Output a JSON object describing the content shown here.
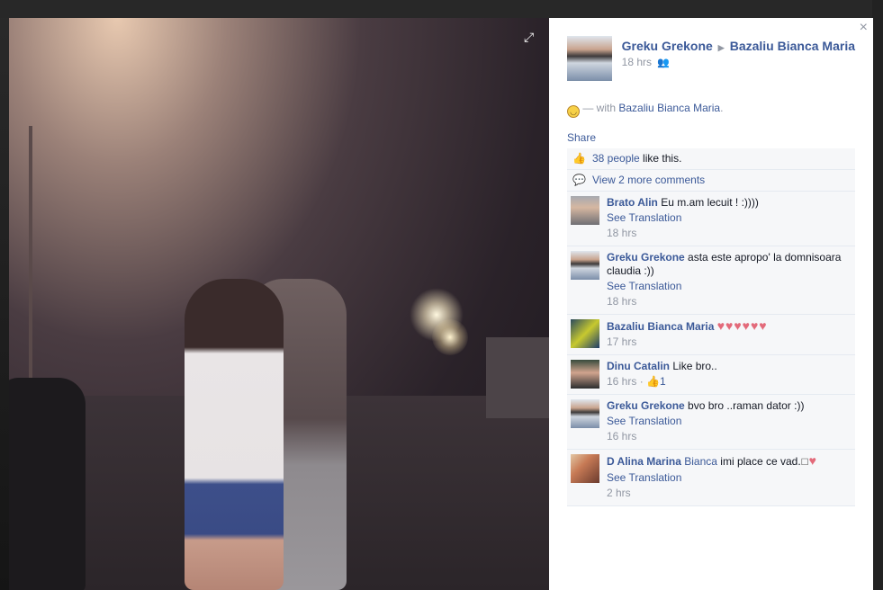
{
  "photo": {
    "expand_icon": "expand-icon"
  },
  "post": {
    "author": "Greku Grekone",
    "target": "Bazaliu Bianca Maria",
    "time": "18 hrs",
    "caption_prefix": "— with",
    "caption_tag": "Bazaliu Bianca Maria",
    "caption_suffix": ".",
    "share_label": "Share"
  },
  "likes": {
    "count_link": "38 people",
    "suffix": " like this."
  },
  "view_more": "View 2 more comments",
  "comments": [
    {
      "author": "Brato Alin",
      "text": "Eu m.am lecuit ! :))))",
      "translation": "See Translation",
      "time": "18 hrs"
    },
    {
      "author": "Greku Grekone",
      "text": "asta este apropo' la domnisoara claudia :))",
      "translation": "See Translation",
      "time": "18 hrs"
    },
    {
      "author": "Bazaliu Bianca Maria",
      "text": "♥♥♥♥♥♥",
      "time": "17 hrs"
    },
    {
      "author": "Dinu Catalin",
      "text": "Like bro..",
      "time": "16 hrs",
      "likes": "1"
    },
    {
      "author": "Greku Grekone",
      "text": "bvo bro ..raman dator :))",
      "translation": "See Translation",
      "time": "16 hrs"
    },
    {
      "author": "D Alina Marina",
      "tag": "Bianca",
      "text": "imi place ce vad.",
      "glyph": "☐",
      "heart": "♥",
      "translation": "See Translation",
      "time": "2 hrs"
    }
  ],
  "icons": {
    "close": "×",
    "expand": "⤢",
    "audience": "👥",
    "like": "👍",
    "comment": "💬",
    "separator": "·"
  }
}
